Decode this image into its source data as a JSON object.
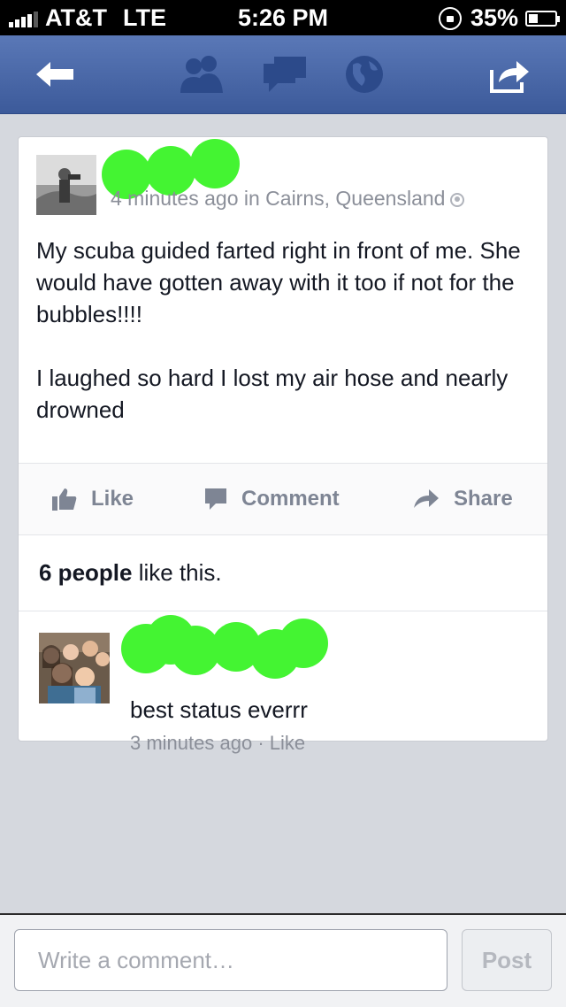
{
  "status_bar": {
    "carrier": "AT&T",
    "network": "LTE",
    "time": "5:26 PM",
    "battery": "35%"
  },
  "nav": {
    "icons": [
      "back-arrow-icon",
      "friends-icon",
      "messages-icon",
      "globe-icon",
      "share-icon"
    ]
  },
  "post": {
    "meta": "4 minutes ago in Cairns, Queensland",
    "paragraphs": [
      "My scuba guided farted right in front of me. She would have gotten away with it too if not for the bubbles!!!!",
      "I laughed so hard I lost my air hose and nearly drowned"
    ],
    "actions": {
      "like": "Like",
      "comment": "Comment",
      "share": "Share"
    },
    "likes": {
      "count": "6 people",
      "suffix": "like this."
    }
  },
  "comment": {
    "text": "best status everrr",
    "time": "3 minutes ago",
    "separator": "·",
    "like": "Like"
  },
  "composer": {
    "placeholder": "Write a comment…",
    "post_label": "Post"
  },
  "colors": {
    "nav_top": "#5a78b7",
    "nav_bottom": "#3c5a9a",
    "redaction": "#44f432",
    "background": "#d5d8de"
  }
}
